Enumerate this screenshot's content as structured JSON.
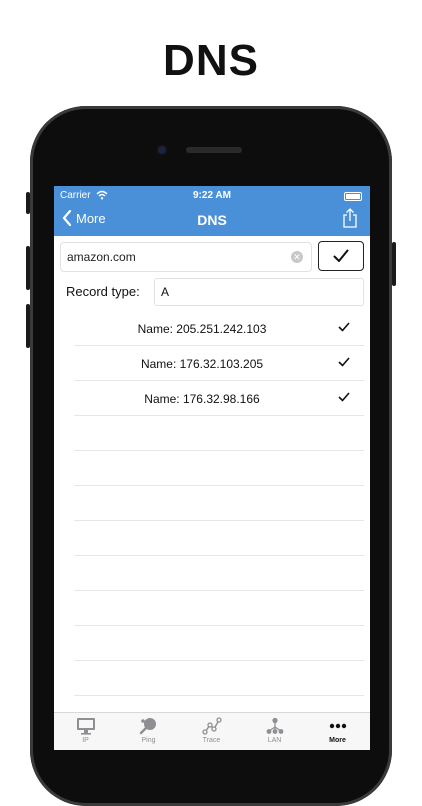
{
  "headline": "DNS",
  "status_bar": {
    "carrier": "Carrier",
    "time": "9:22 AM"
  },
  "nav": {
    "back_label": "More",
    "title": "DNS"
  },
  "query": {
    "domain": "amazon.com",
    "record_type_label": "Record type:",
    "record_type_value": "A"
  },
  "results": [
    {
      "label": "Name: 205.251.242.103"
    },
    {
      "label": "Name: 176.32.103.205"
    },
    {
      "label": "Name: 176.32.98.166"
    }
  ],
  "tabs": [
    {
      "label": "IP",
      "icon": "monitor-icon"
    },
    {
      "label": "Ping",
      "icon": "ping-paddle-icon"
    },
    {
      "label": "Trace",
      "icon": "trace-route-icon"
    },
    {
      "label": "LAN",
      "icon": "lan-network-icon"
    },
    {
      "label": "More",
      "icon": "more-dots-icon",
      "active": true
    }
  ],
  "colors": {
    "nav_bar": "#4a90d9",
    "tab_inactive": "#8e8e93",
    "tab_active": "#111111"
  }
}
